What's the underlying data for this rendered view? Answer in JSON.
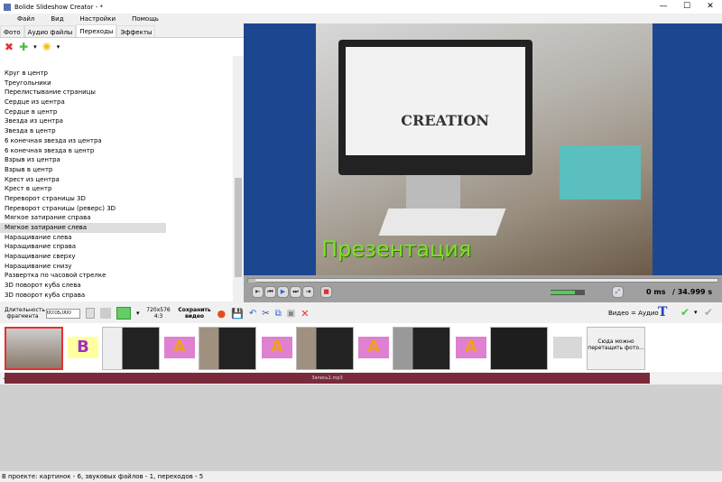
{
  "window": {
    "title": "Bolide Slideshow Creator - *",
    "min": "—",
    "max": "☐",
    "close": "✕"
  },
  "menu": [
    "Файл",
    "Вид",
    "Настройки",
    "Помощь"
  ],
  "tabs": [
    "Фото",
    "Аудио файлы",
    "Переходы",
    "Эффекты"
  ],
  "transitions": [
    "Круг в центр",
    "Треугольники",
    "Перелистывание страницы",
    "Сердце из центра",
    "Сердце в центр",
    "Звезда из центра",
    "Звезда в центр",
    "6 конечная звезда из центра",
    "6 конечная звезда в центр",
    "Взрыв из центра",
    "Взрыв в центр",
    "Крест из центра",
    "Крест в центр",
    "Переворот страницы 3D",
    "Переворот страницы (реверс) 3D",
    "Мягкое затирание справа",
    "Мягкое затирание слева",
    "Наращивание слева",
    "Наращивание справа",
    "Наращивание сверху",
    "Наращивание снизу",
    "Развертка по часовой стрелке",
    "3D поворот куба слева",
    "3D поворот куба справа"
  ],
  "selected_transition": "Мягкое затирание слева",
  "preview": {
    "caption": "Презентация",
    "monitor_text": "CREATION"
  },
  "player": {
    "time": "0 ms",
    "duration": "/ 34.999 s",
    "volume": 0.7
  },
  "toolbar2": {
    "duration_label": "Длительность фрагмента",
    "duration_value": "00:05,000",
    "resolution": "720x576",
    "aspect": "4:3",
    "save_label": "Сохранить видео",
    "video_audio": "Видео = Аудио"
  },
  "timeline": {
    "transition_letters": [
      "B",
      "A",
      "A",
      "A",
      "A"
    ],
    "drop_hint": "Сюда можно перетащить фото..."
  },
  "audio_track": "Запись1.mp3",
  "status": "В проекте: картинок - 6, звуковых файлов - 1, переходов - 5",
  "colors": {
    "accent_red": "#e53030",
    "audio": "#7a2a3a",
    "slide_border": "#1d4690"
  }
}
